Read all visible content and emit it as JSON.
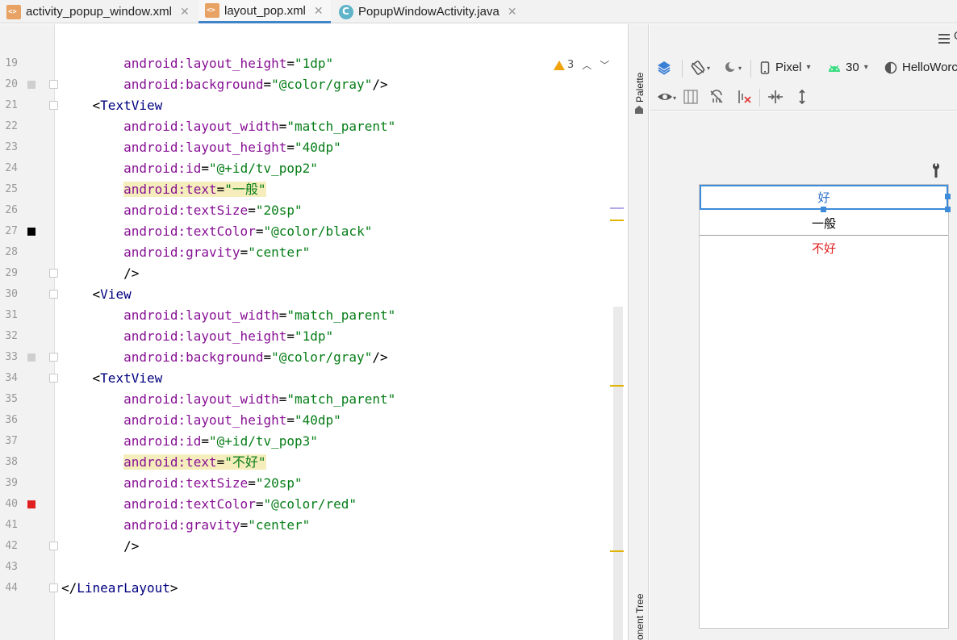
{
  "tabs": [
    {
      "label": "activity_popup_window.xml",
      "type": "xml",
      "active": false
    },
    {
      "label": "layout_pop.xml",
      "type": "xml",
      "active": true
    },
    {
      "label": "PopupWindowActivity.java",
      "type": "java",
      "active": false
    }
  ],
  "editor": {
    "warning_count": "3",
    "lines": [
      {
        "n": "19",
        "indent": "    ",
        "attr": "android:layout_height",
        "value": "\"1dp\""
      },
      {
        "n": "20",
        "indent": "    ",
        "attr": "android:background",
        "value": "\"@color/gray\"",
        "tail": "/>"
      },
      {
        "n": "21",
        "tagline": "<TextView"
      },
      {
        "n": "22",
        "indent": "    ",
        "attr": "android:layout_width",
        "value": "\"match_parent\""
      },
      {
        "n": "23",
        "indent": "    ",
        "attr": "android:layout_height",
        "value": "\"40dp\""
      },
      {
        "n": "24",
        "indent": "    ",
        "attr": "android:id",
        "value": "\"@+id/tv_pop2\""
      },
      {
        "n": "25",
        "indent": "    ",
        "attr": "android:text",
        "value": "\"一般\"",
        "highlight": true
      },
      {
        "n": "26",
        "indent": "    ",
        "attr": "android:textSize",
        "value": "\"20sp\""
      },
      {
        "n": "27",
        "indent": "    ",
        "attr": "android:textColor",
        "value": "\"@color/black\""
      },
      {
        "n": "28",
        "indent": "    ",
        "attr": "android:gravity",
        "value": "\"center\""
      },
      {
        "n": "29",
        "closing": "/>"
      },
      {
        "n": "30",
        "tagline": "<View"
      },
      {
        "n": "31",
        "indent": "    ",
        "attr": "android:layout_width",
        "value": "\"match_parent\""
      },
      {
        "n": "32",
        "indent": "    ",
        "attr": "android:layout_height",
        "value": "\"1dp\""
      },
      {
        "n": "33",
        "indent": "    ",
        "attr": "android:background",
        "value": "\"@color/gray\"",
        "tail": "/>"
      },
      {
        "n": "34",
        "tagline": "<TextView"
      },
      {
        "n": "35",
        "indent": "    ",
        "attr": "android:layout_width",
        "value": "\"match_parent\""
      },
      {
        "n": "36",
        "indent": "    ",
        "attr": "android:layout_height",
        "value": "\"40dp\""
      },
      {
        "n": "37",
        "indent": "    ",
        "attr": "android:id",
        "value": "\"@+id/tv_pop3\""
      },
      {
        "n": "38",
        "indent": "    ",
        "attr": "android:text",
        "value": "\"不好\"",
        "highlight": true
      },
      {
        "n": "39",
        "indent": "    ",
        "attr": "android:textSize",
        "value": "\"20sp\""
      },
      {
        "n": "40",
        "indent": "    ",
        "attr": "android:textColor",
        "value": "\"@color/red\""
      },
      {
        "n": "41",
        "indent": "    ",
        "attr": "android:gravity",
        "value": "\"center\""
      },
      {
        "n": "42",
        "closing": "/>"
      },
      {
        "n": "43"
      },
      {
        "n": "44",
        "endtag": "</LinearLayout>"
      }
    ],
    "gutter_colors": {
      "27": "#000000",
      "40": "#e02020"
    }
  },
  "sidebar": {
    "palette_label": "Palette",
    "component_tree_label": "onent Tree"
  },
  "design": {
    "device_label": "Pixel",
    "api_label": "30",
    "theme_label": "HelloWorc",
    "preview_items": [
      {
        "text": "好",
        "color": "#2a6fc9"
      },
      {
        "text": "一般",
        "color": "#000000"
      },
      {
        "text": "不好",
        "color": "#e02020"
      }
    ]
  },
  "colors": {
    "accent": "#3d8bd9",
    "attr": "#871094",
    "string": "#067d17",
    "tag": "#000080",
    "highlight": "#f5edbc"
  }
}
